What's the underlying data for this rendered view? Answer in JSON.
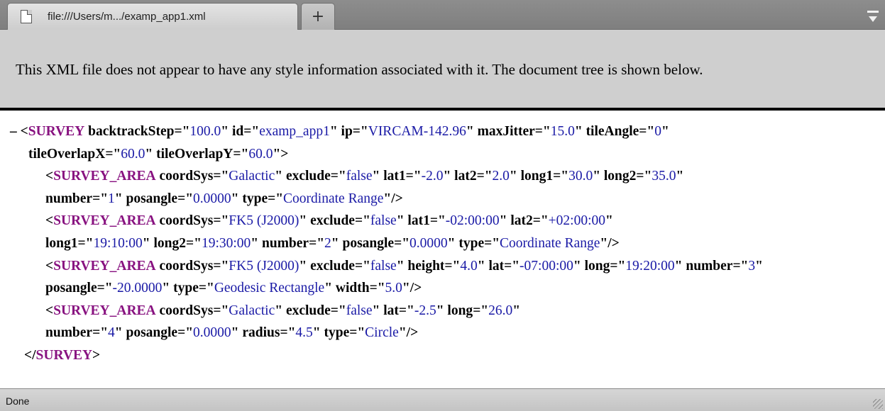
{
  "tabs": [
    {
      "title": "file:///Users/m.../examp_app1.xml",
      "icon": "document-icon"
    }
  ],
  "new_tab_label": "+",
  "info_message": "This XML file does not appear to have any style information associated with it. The document tree is shown below.",
  "xml": {
    "collapse_symbol": "–",
    "root_tag": "SURVEY",
    "root_attributes": [
      {
        "name": "backtrackStep",
        "value": "100.0"
      },
      {
        "name": "id",
        "value": "examp_app1"
      },
      {
        "name": "ip",
        "value": "VIRCAM-142.96"
      },
      {
        "name": "maxJitter",
        "value": "15.0"
      },
      {
        "name": "tileAngle",
        "value": "0"
      },
      {
        "name": "tileOverlapX",
        "value": "60.0"
      },
      {
        "name": "tileOverlapY",
        "value": "60.0"
      }
    ],
    "children": [
      {
        "tag": "SURVEY_AREA",
        "attributes": [
          {
            "name": "coordSys",
            "value": "Galactic"
          },
          {
            "name": "exclude",
            "value": "false"
          },
          {
            "name": "lat1",
            "value": "-2.0"
          },
          {
            "name": "lat2",
            "value": "2.0"
          },
          {
            "name": "long1",
            "value": "30.0"
          },
          {
            "name": "long2",
            "value": "35.0"
          },
          {
            "name": "number",
            "value": "1"
          },
          {
            "name": "posangle",
            "value": "0.0000"
          },
          {
            "name": "type",
            "value": "Coordinate Range"
          }
        ]
      },
      {
        "tag": "SURVEY_AREA",
        "attributes": [
          {
            "name": "coordSys",
            "value": "FK5 (J2000)"
          },
          {
            "name": "exclude",
            "value": "false"
          },
          {
            "name": "lat1",
            "value": "-02:00:00"
          },
          {
            "name": "lat2",
            "value": "+02:00:00"
          },
          {
            "name": "long1",
            "value": "19:10:00"
          },
          {
            "name": "long2",
            "value": "19:30:00"
          },
          {
            "name": "number",
            "value": "2"
          },
          {
            "name": "posangle",
            "value": "0.0000"
          },
          {
            "name": "type",
            "value": "Coordinate Range"
          }
        ]
      },
      {
        "tag": "SURVEY_AREA",
        "attributes": [
          {
            "name": "coordSys",
            "value": "FK5 (J2000)"
          },
          {
            "name": "exclude",
            "value": "false"
          },
          {
            "name": "height",
            "value": "4.0"
          },
          {
            "name": "lat",
            "value": "-07:00:00"
          },
          {
            "name": "long",
            "value": "19:20:00"
          },
          {
            "name": "number",
            "value": "3"
          },
          {
            "name": "posangle",
            "value": "-20.0000"
          },
          {
            "name": "type",
            "value": "Geodesic Rectangle"
          },
          {
            "name": "width",
            "value": "5.0"
          }
        ]
      },
      {
        "tag": "SURVEY_AREA",
        "attributes": [
          {
            "name": "coordSys",
            "value": "Galactic"
          },
          {
            "name": "exclude",
            "value": "false"
          },
          {
            "name": "lat",
            "value": "-2.5"
          },
          {
            "name": "long",
            "value": "26.0"
          },
          {
            "name": "number",
            "value": "4"
          },
          {
            "name": "posangle",
            "value": "0.0000"
          },
          {
            "name": "radius",
            "value": "4.5"
          },
          {
            "name": "type",
            "value": "Circle"
          }
        ]
      }
    ]
  },
  "status_text": "Done",
  "colors": {
    "tag": "#881280",
    "attr_value": "#1a1aa6",
    "banner": "#cfcfcf"
  }
}
